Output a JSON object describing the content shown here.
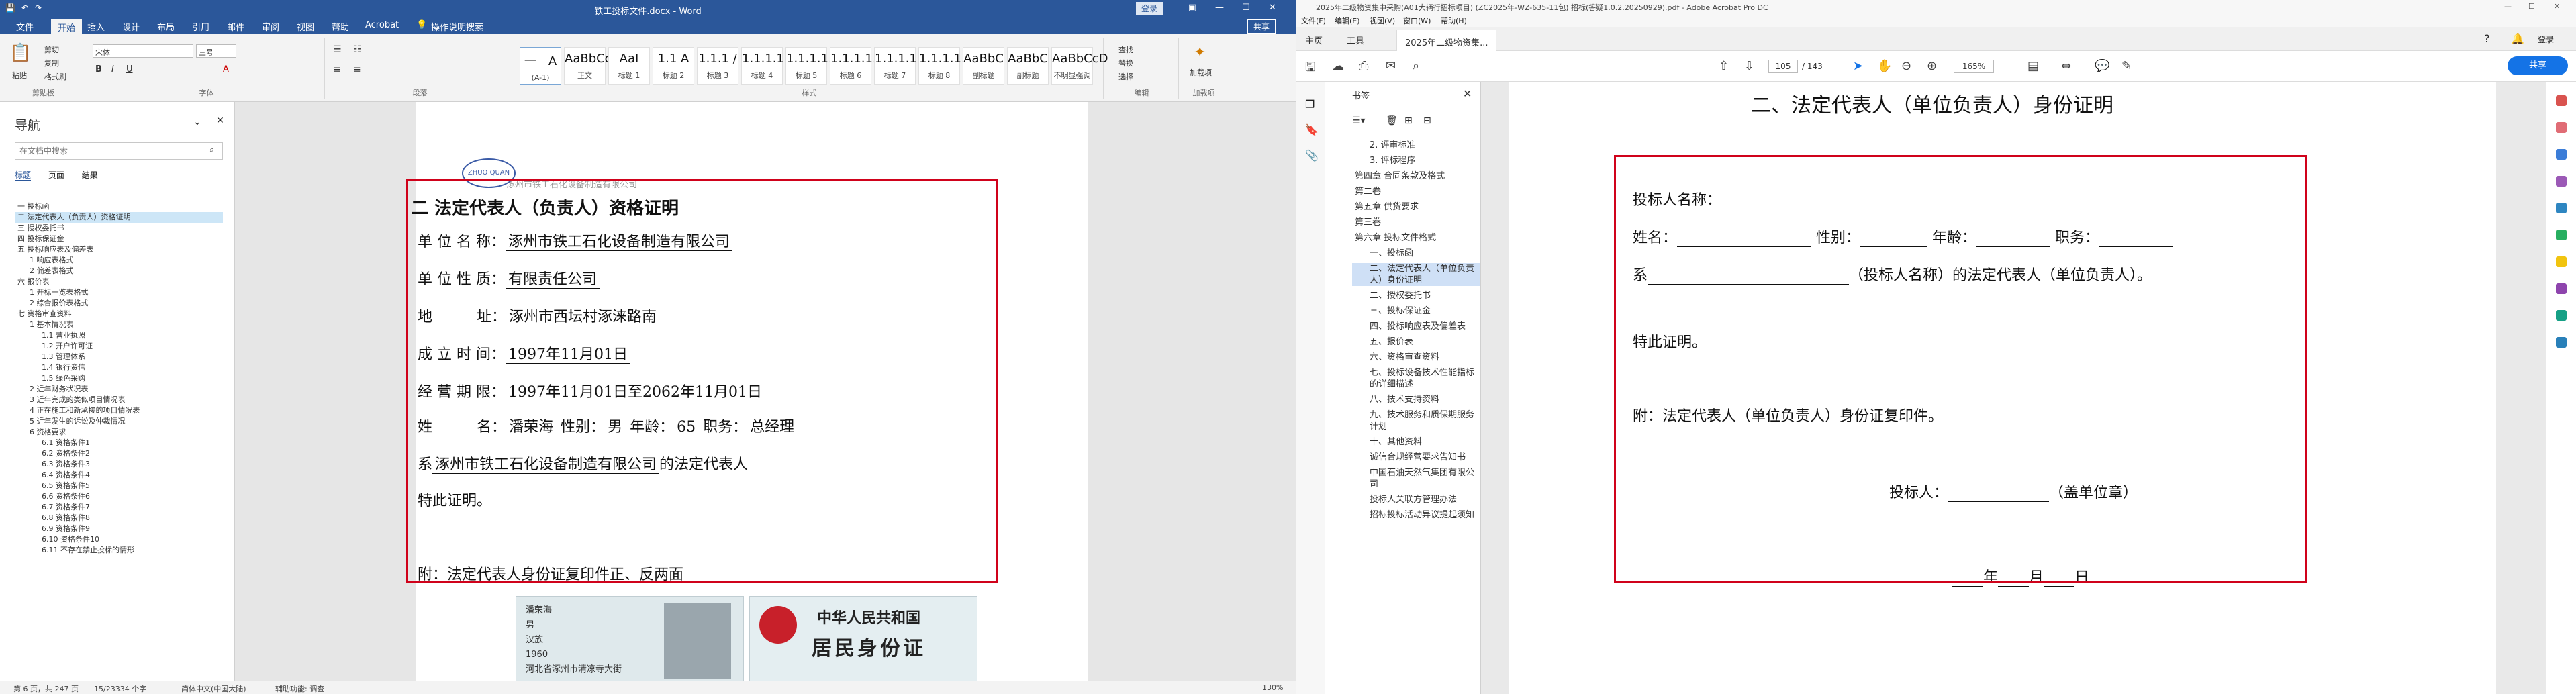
{
  "word": {
    "title": "铁工投标文件.docx  -  Word",
    "tabs": [
      "文件",
      "开始",
      "插入",
      "设计",
      "布局",
      "引用",
      "邮件",
      "审阅",
      "视图",
      "帮助",
      "Acrobat",
      "操作说明搜索"
    ],
    "active_tab": "开始",
    "share": "共享",
    "groups": [
      "剪贴板",
      "字体",
      "段落",
      "样式",
      "编辑",
      "加载项"
    ],
    "clipboard": [
      "粘贴",
      "剪切",
      "复制",
      "格式刷"
    ],
    "font": {
      "name": "宋体",
      "size": "三号"
    },
    "styles": [
      {
        "preview": "一　A",
        "name": "(A-1)"
      },
      {
        "preview": "AaBbCcD",
        "name": "正文"
      },
      {
        "preview": "AaI",
        "name": "标题 1"
      },
      {
        "preview": "1.1 A",
        "name": "标题 2"
      },
      {
        "preview": "1.1.1 /",
        "name": "标题 3"
      },
      {
        "preview": "1.1.1.1",
        "name": "标题 4"
      },
      {
        "preview": "1.1.1.1.",
        "name": "标题 5"
      },
      {
        "preview": "1.1.1.1.",
        "name": "标题 6"
      },
      {
        "preview": "1.1.1.1.",
        "name": "标题 7"
      },
      {
        "preview": "1.1.1.1.",
        "name": "标题 8"
      },
      {
        "preview": "AaBbC",
        "name": "副标题"
      },
      {
        "preview": "AaBbC",
        "name": "副标题"
      },
      {
        "preview": "AaBbCcD",
        "name": "不明显强调"
      }
    ],
    "edit": [
      "查找",
      "替换",
      "选择"
    ],
    "addin": "加载项",
    "nav": {
      "title": "导航",
      "search_placeholder": "在文档中搜索",
      "tabs": [
        "标题",
        "页面",
        "结果"
      ],
      "items": [
        "一 投标函",
        "二 法定代表人（负责人）资格证明",
        "三 授权委托书",
        "四 投标保证金",
        "五 投标响应表及偏差表",
        "1 响应表格式",
        "2 偏差表格式",
        "六 报价表",
        "1 开标一览表格式",
        "2 综合报价表格式",
        "七 资格审查资料",
        "1 基本情况表",
        "1.1 营业执照",
        "1.2 开户许可证",
        "1.3 管理体系",
        "1.4 银行资信",
        "1.5 绿色采购",
        "2 近年财务状况表",
        "3 近年完成的类似项目情况表",
        "4 正在施工和新承接的项目情况表",
        "5 近年发生的诉讼及仲裁情况",
        "6 资格要求",
        "6.1 资格条件1",
        "6.2 资格条件2",
        "6.3 资格条件3",
        "6.4 资格条件4",
        "6.5 资格条件5",
        "6.6 资格条件6",
        "6.7 资格条件7",
        "6.8 资格条件8",
        "6.9 资格条件9",
        "6.10 资格条件10",
        "6.11 不存在禁止投标的情形"
      ],
      "selected_index": 1
    },
    "doc": {
      "header_company": "涿州市铁工石化设备制造有限公司",
      "heading": "二 法定代表人（负责人）资格证明",
      "rows": [
        {
          "label": "单 位 名 称：",
          "value": "涿州市铁工石化设备制造有限公司"
        },
        {
          "label": "单 位 性 质：",
          "value": "有限责任公司"
        },
        {
          "label": "地　　　址：",
          "value": "涿州市西坛村涿涞路南"
        },
        {
          "label": "成 立 时 间：",
          "value": "1997年11月01日"
        },
        {
          "label": "经 营 期 限：",
          "value": "1997年11月01日至2062年11月01日"
        }
      ],
      "person": {
        "name_label": "姓　　　名：",
        "name": "潘荣海",
        "gender_label": "性别：",
        "gender": "男",
        "age_label": "年龄：",
        "age": "65",
        "title_label": "职务：",
        "title": "总经理"
      },
      "line_xi_prefix": "系",
      "line_xi_company": "涿州市铁工石化设备制造有限公司",
      "line_xi_suffix": "的法定代表人",
      "certify": "特此证明。",
      "attach": "附：法定代表人身份证复印件正、反两面",
      "id_front": {
        "name": "潘荣海",
        "gender": "男",
        "ethnic": "汉族",
        "year": "1960",
        "addr": "河北省涿州市清凉寺大街"
      },
      "id_back": {
        "line1": "中华人民共和国",
        "line2": "居民身份证"
      }
    },
    "status": {
      "page": "第 6 页，共 247 页",
      "words": "15/23334 个字",
      "lang": "简体中文(中国大陆)",
      "mode": "辅助功能: 调查",
      "zoom": "130%"
    }
  },
  "acrobat": {
    "title": "2025年二级物资集中采购(A01大辆行招标项目) (ZC2025年-WZ-635-11包) 招标(答疑1.0.2.20250929).pdf - Adobe Acrobat Pro DC",
    "menu": [
      "文件(F)",
      "编辑(E)",
      "视图(V)",
      "窗口(W)",
      "帮助(H)"
    ],
    "tabs": [
      "主页",
      "工具",
      "2025年二级物资集..."
    ],
    "page_current": "105",
    "page_total": "/ 143",
    "zoom": "165%",
    "share": "共享",
    "bookmarks_title": "书签",
    "bookmarks": [
      "2. 评审标准",
      "3. 评标程序",
      "第四章 合同条款及格式",
      "第二卷",
      "第五章 供货要求",
      "第三卷",
      "第六章 投标文件格式",
      "一、投标函",
      "二、法定代表人（单位负责人）身份证明",
      "二、授权委托书",
      "三、投标保证金",
      "四、投标响应表及偏差表",
      "五、报价表",
      "六、资格审查资料",
      "七、投标设备技术性能指标的详细描述",
      "八、技术支持资料",
      "九、技术服务和质保期服务计划",
      "十、其他资料",
      "诚信合规经营要求告知书",
      "中国石油天然气集团有限公司",
      "投标人关联方管理办法",
      "招标投标活动异议提起须知"
    ],
    "bookmark_selected": 8,
    "pdf": {
      "heading": "二、法定代表人（单位负责人）身份证明",
      "bidder_label": "投标人名称：",
      "line_name": "姓名：",
      "line_gender": "性别：",
      "line_age": "年龄：",
      "line_title": "职务：",
      "line_xi": "系",
      "line_xi_suffix": "（投标人名称）的法定代表人（单位负责人）。",
      "certify": "特此证明。",
      "attach": "附：法定代表人（单位负责人）身份证复印件。",
      "seal": "投标人：",
      "seal_suffix": "（盖单位章）",
      "date_y": "年",
      "date_m": "月",
      "date_d": "日"
    }
  }
}
